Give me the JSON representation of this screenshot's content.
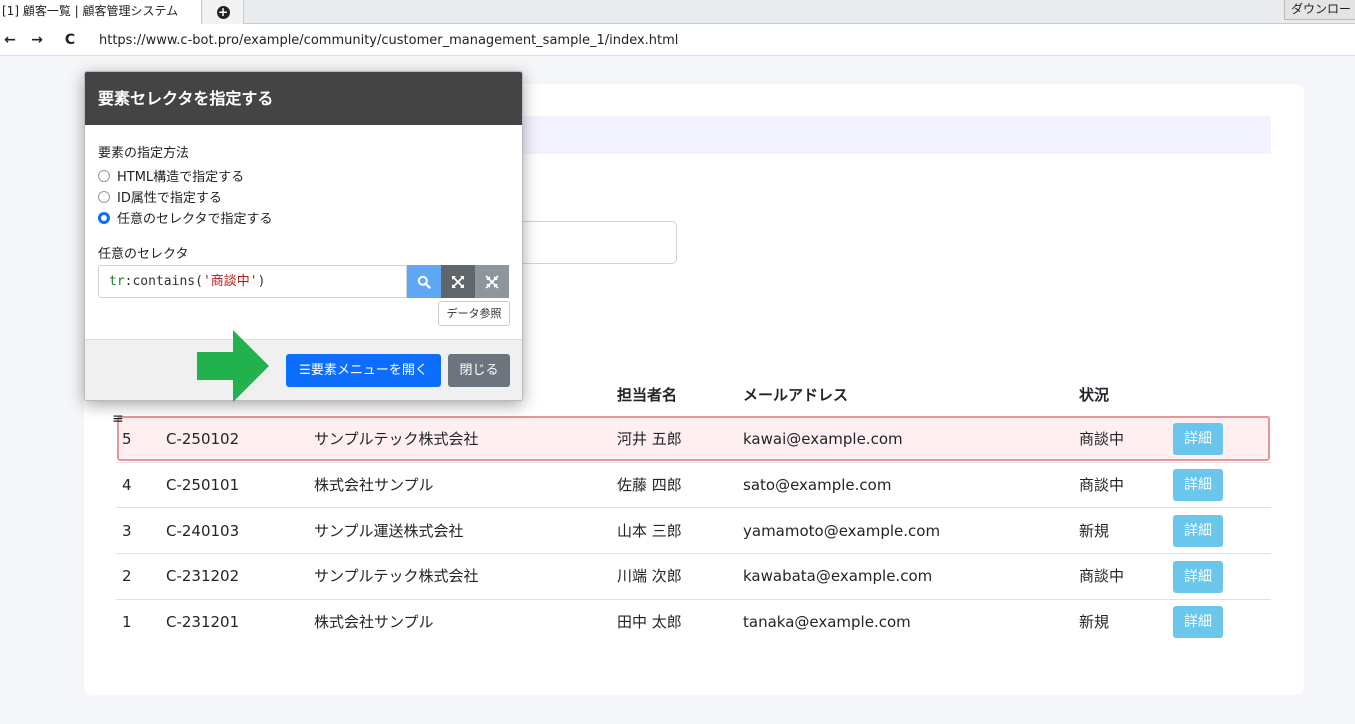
{
  "browser": {
    "tab_title": "[1] 顧客一覧 | 顧客管理システム",
    "new_tab_icon": "plus-circle-icon",
    "download_label": "ダウンロー",
    "url": "https://www.c-bot.pro/example/community/customer_management_sample_1/index.html",
    "back_icon": "←",
    "forward_icon": "→",
    "reload_icon": "C"
  },
  "table": {
    "headers": [
      "担当者名",
      "メールアドレス",
      "状況"
    ],
    "rows": [
      {
        "no": "5",
        "code": "C-250102",
        "company": "サンプルテック株式会社",
        "person": "河井 五郎",
        "email": "kawai@example.com",
        "status": "商談中",
        "detail": "詳細"
      },
      {
        "no": "4",
        "code": "C-250101",
        "company": "株式会社サンプル",
        "person": "佐藤 四郎",
        "email": "sato@example.com",
        "status": "商談中",
        "detail": "詳細"
      },
      {
        "no": "3",
        "code": "C-240103",
        "company": "サンプル運送株式会社",
        "person": "山本 三郎",
        "email": "yamamoto@example.com",
        "status": "新規",
        "detail": "詳細"
      },
      {
        "no": "2",
        "code": "C-231202",
        "company": "サンプルテック株式会社",
        "person": "川端 次郎",
        "email": "kawabata@example.com",
        "status": "商談中",
        "detail": "詳細"
      },
      {
        "no": "1",
        "code": "C-231201",
        "company": "株式会社サンプル",
        "person": "田中 太郎",
        "email": "tanaka@example.com",
        "status": "新規",
        "detail": "詳細"
      }
    ]
  },
  "dialog": {
    "title": "要素セレクタを指定する",
    "method_label": "要素の指定方法",
    "options": [
      "HTML構造で指定する",
      "ID属性で指定する",
      "任意のセレクタで指定する"
    ],
    "selected_option": "任意のセレクタで指定する",
    "selector_label": "任意のセレクタ",
    "selector_parts": {
      "tag": "tr",
      "pseudo": ":contains(",
      "quote_open": "'",
      "arg": "商談中",
      "quote_close": "'",
      "close": ")"
    },
    "data_ref_label": "データ参照",
    "open_menu_label": "☰要素メニューを開く",
    "close_label": "閉じる"
  },
  "colors": {
    "primary": "#0d6efd",
    "secondary": "#6c757d",
    "detail_button": "#5bc0eb",
    "highlight_border": "#e6959a",
    "arrow": "#22b14c",
    "dialog_header": "#444444"
  }
}
